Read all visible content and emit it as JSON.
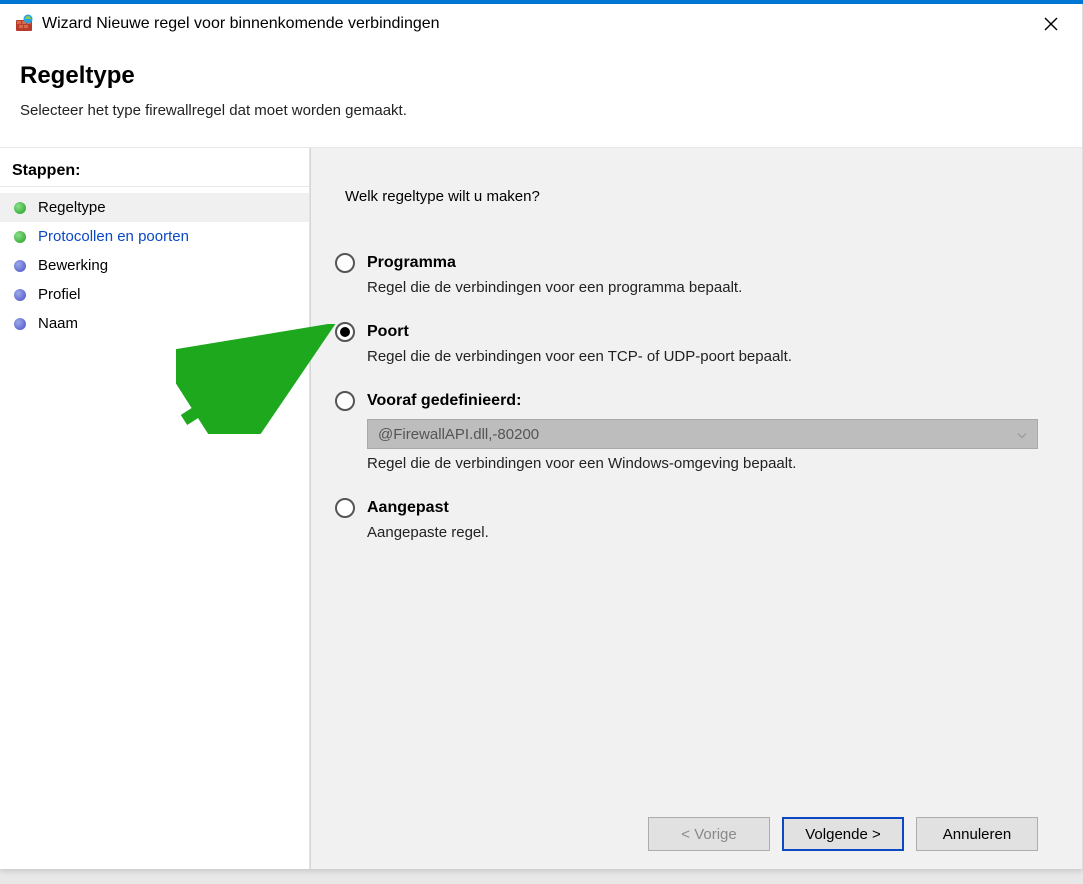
{
  "window": {
    "title": "Wizard Nieuwe regel voor binnenkomende verbindingen"
  },
  "header": {
    "heading": "Regeltype",
    "subtitle": "Selecteer het type firewallregel dat moet worden gemaakt."
  },
  "sidebar": {
    "steps_label": "Stappen:",
    "items": [
      {
        "label": "Regeltype"
      },
      {
        "label": "Protocollen en poorten"
      },
      {
        "label": "Bewerking"
      },
      {
        "label": "Profiel"
      },
      {
        "label": "Naam"
      }
    ]
  },
  "content": {
    "question": "Welk regeltype wilt u maken?",
    "options": [
      {
        "label": "Programma",
        "description": "Regel die de verbindingen voor een programma bepaalt."
      },
      {
        "label": "Poort",
        "description": "Regel die de verbindingen voor een TCP- of UDP-poort bepaalt."
      },
      {
        "label": "Vooraf gedefinieerd:",
        "combo_value": "@FirewallAPI.dll,-80200",
        "description": "Regel die de verbindingen voor een Windows-omgeving bepaalt."
      },
      {
        "label": "Aangepast",
        "description": "Aangepaste regel."
      }
    ]
  },
  "footer": {
    "back": "< Vorige",
    "next": "Volgende >",
    "cancel": "Annuleren"
  }
}
